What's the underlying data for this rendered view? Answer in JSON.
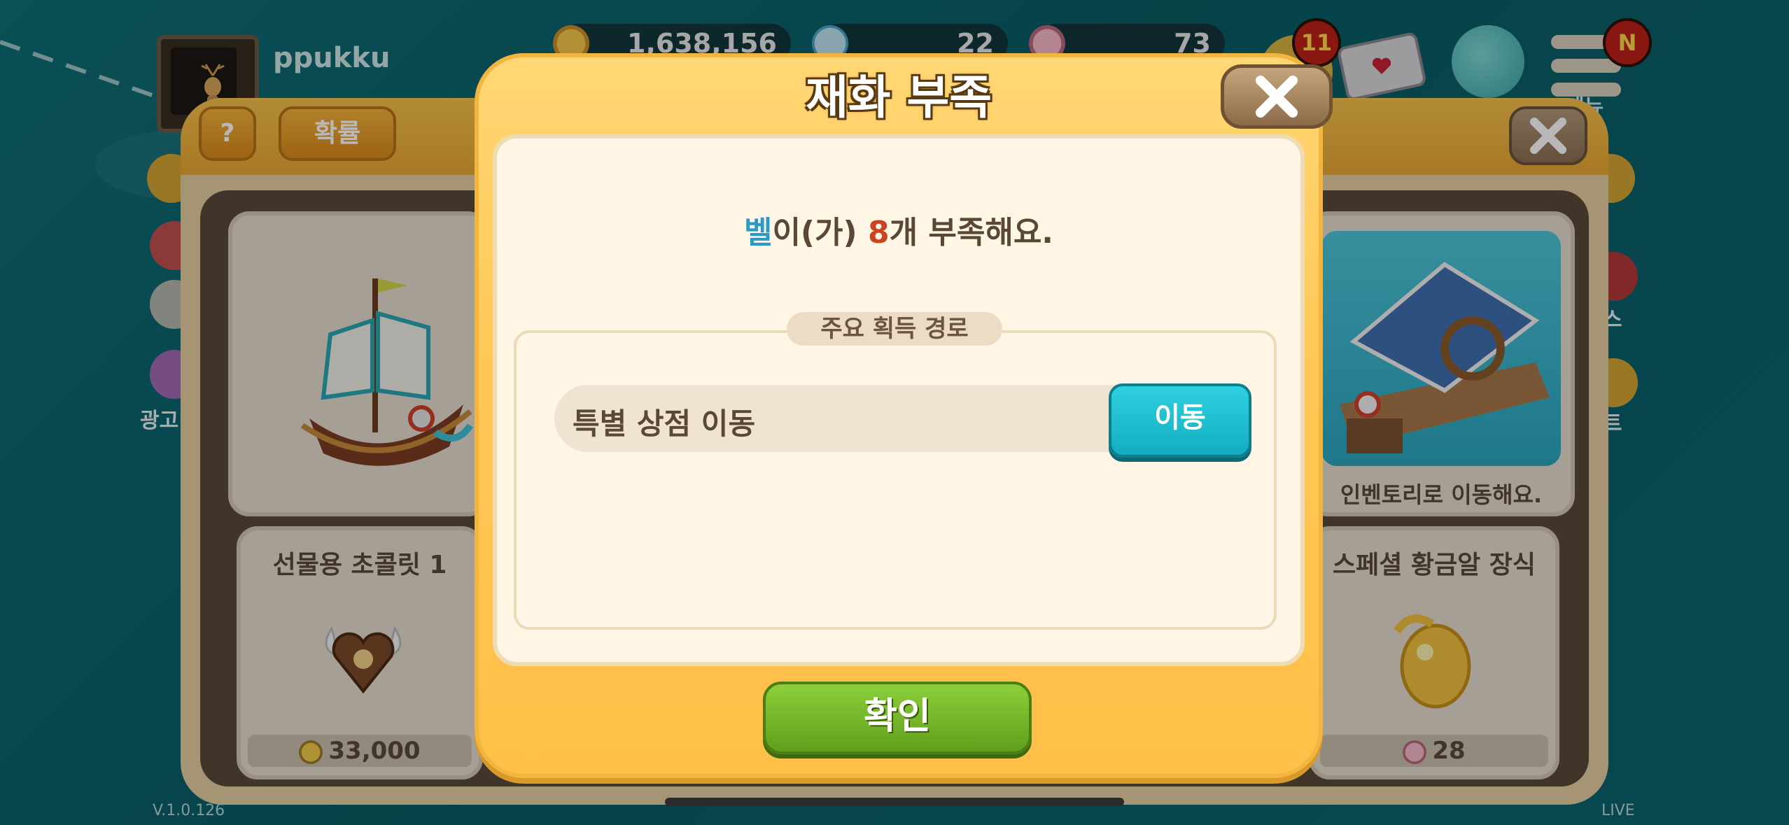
{
  "hud": {
    "username": "ppukku",
    "coins": "1,638,156",
    "drops": "22",
    "hearts": "73",
    "notif_count": "11",
    "menu_badge": "N",
    "menu_label": "메뉴"
  },
  "panel": {
    "help_label": "?",
    "prob_label": "확률",
    "items": [
      {
        "title": "선물용 초콜릿 1",
        "price": "33,000"
      },
      {
        "title": "스페셜 황금알 장식",
        "price": "28"
      }
    ],
    "inventory_note": "인벤토리로 이동해요.",
    "side_labels": [
      "광고",
      "스",
      "트"
    ]
  },
  "dialog": {
    "title": "재화 부족",
    "message_item": "벨",
    "message_part1": "이(가) ",
    "message_count": "8",
    "message_part2": "개 부족해요.",
    "source_header": "주요 획득 경로",
    "route_label": "특별 상점 이동",
    "move_label": "이동",
    "confirm_label": "확인"
  },
  "footer": {
    "version": "V.1.0.126",
    "live": "LIVE"
  },
  "colors": {
    "accent_item": "#2a9bc5",
    "accent_count": "#c9451f",
    "move_button": "#12aebf",
    "confirm_button": "#5f9f1c"
  }
}
